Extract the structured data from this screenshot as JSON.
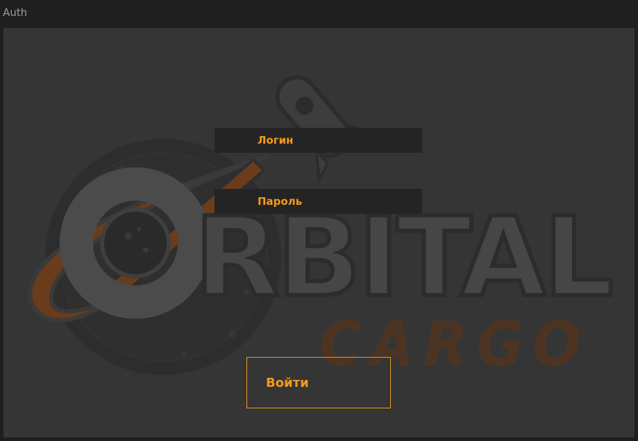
{
  "window": {
    "title": "Auth"
  },
  "logo": {
    "name": "orbital-cargo-logo",
    "text_main": "ORBITAL",
    "text_sub": "CARGO"
  },
  "form": {
    "login_placeholder": "Логин",
    "password_placeholder": "Пароль",
    "submit_label": "Войти"
  },
  "colors": {
    "accent": "#f39a1e",
    "background": "#353535",
    "field_background": "#242424",
    "titlebar": "#1f1f1f"
  }
}
